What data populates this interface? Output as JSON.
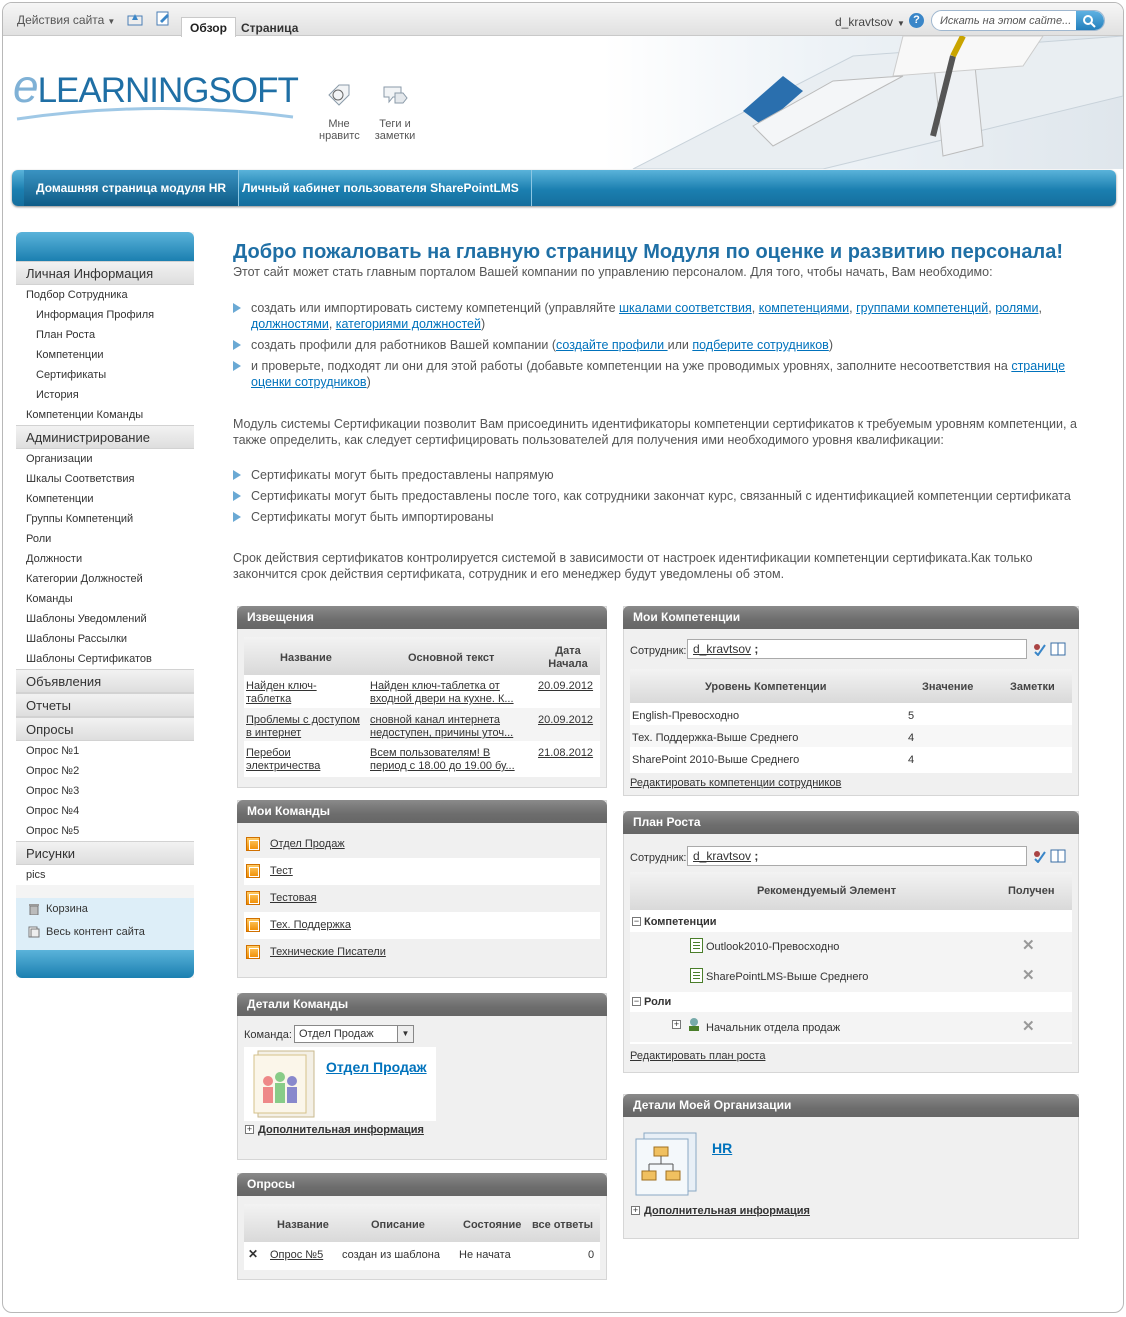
{
  "ribbon": {
    "site_actions": "Действия сайта",
    "tab_browse": "Обзор",
    "tab_page": "Страница",
    "user": "d_kravtsov",
    "search_placeholder": "Искать на этом сайте..."
  },
  "header": {
    "logo": "LEARNINGSOFT",
    "logo_e": "e",
    "like_label": "Мне нравитс",
    "tags_label": "Теги и заметки"
  },
  "topnav": {
    "home": "Домашняя страница модуля HR",
    "cabinet": "Личный кабинет пользователя SharePointLMS"
  },
  "sidebar": {
    "h_personal": "Личная Информация",
    "employee_selection": "Подбор Сотрудника",
    "profile_info": "Информация Профиля",
    "growth_plan": "План Роста",
    "competencies": "Компетенции",
    "certificates": "Сертификаты",
    "history": "История",
    "team_competencies": "Компетенции Команды",
    "h_admin": "Администрирование",
    "organizations": "Организации",
    "scales": "Шкалы Соответствия",
    "admin_competencies": "Компетенции",
    "competency_groups": "Группы Компетенций",
    "roles": "Роли",
    "positions": "Должности",
    "position_categories": "Категории Должностей",
    "teams": "Команды",
    "notify_templates": "Шаблоны Уведомлений",
    "mail_templates": "Шаблоны Рассылки",
    "cert_templates": "Шаблоны Сертификатов",
    "h_announcements": "Объявления",
    "h_reports": "Отчеты",
    "h_surveys": "Опросы",
    "survey1": "Опрос №1",
    "survey2": "Опрос №2",
    "survey3": "Опрос №3",
    "survey4": "Опрос №4",
    "survey5": "Опрос №5",
    "h_pictures": "Рисунки",
    "pics": "pics",
    "recycle": "Корзина",
    "all_content": "Весь контент сайта"
  },
  "main": {
    "title": "Добро пожаловать на главную страницу Модуля по оценке и развитию персонала!",
    "intro": "Этот сайт может стать главным порталом Вашей компании по управлению персоналом. Для того, чтобы начать, Вам необходимо:",
    "b1_text": "создать или импортировать систему компетенций (управляйте ",
    "b1_l1": "шкалами соответствия",
    "b1_l2": "компетенциями",
    "b1_l3": "группами компетенций",
    "b1_l4": "ролями",
    "b1_l5": "должностями",
    "b1_l6": "категориями должностей",
    "b2_text": "создать профили для работников Вашей компании (",
    "b2_l1": "создайте профили ",
    "b2_mid": "или ",
    "b2_l2": "подберите сотрудников",
    "b3_text": "и проверьте, подходят ли они для этой работы (добавьте компетенции на уже проводимых уровнях, заполните несоответствия на ",
    "b3_l1": "странице",
    "b3_l2": "оценки сотрудников",
    "cert_para": "Модуль системы Сертификации позволит Вам присоединить идентификаторы компетенции сертификатов к требуемым уровням компетенции, а также определить, как следует сертифицировать пользователей для получения ими необходимого уровня квалификации:",
    "c1": "Сертификаты могут быть предоставлены напрямую",
    "c2": "Сертификаты могут быть предоставлены после того, как сотрудники закончат курс, связанный с идентификацией компетенции сертификата",
    "c3": "Сертификаты могут быть импортированы",
    "expiry_para": "Срок действия сертификатов контролируется системой в зависимости от настроек идентификации компетенции сертификата.Как только закончится срок действия сертификата, сотрудник и его менеджер будут уведомлены об этом."
  },
  "notices": {
    "title": "Извещения",
    "col_name": "Название",
    "col_body": "Основной текст",
    "col_date": "Дата Начала",
    "rows": [
      {
        "name": "Найден ключ-таблетка",
        "body": "Найден ключ-таблетка от входной двери на кухне. К...",
        "date": "20.09.2012"
      },
      {
        "name": "Проблемы с доступом в интернет",
        "body": "сновной канал интернета недоступен, причины уточ...",
        "date": "20.09.2012"
      },
      {
        "name": "Перебои электричества",
        "body": "Всем пользователям! В период с 18.00 до 19.00 бу...",
        "date": "21.08.2012"
      }
    ]
  },
  "my_teams": {
    "title": "Мои Команды",
    "items": [
      "Отдел Продаж",
      "Тест",
      "Тестовая",
      "Тех. Поддержка",
      "Технические Писатели"
    ]
  },
  "team_details": {
    "title": "Детали Команды",
    "label": "Команда:",
    "selected": "Отдел Продаж",
    "team_name": "Отдел Продаж",
    "more": "Дополнительная информация"
  },
  "surveys": {
    "title": "Опросы",
    "col_name": "Название",
    "col_desc": "Описание",
    "col_status": "Состояние",
    "col_answers": "все ответы",
    "rows": [
      {
        "name": "Опрос №5",
        "desc": "создан из шаблона",
        "status": "Не начата",
        "answers": "0"
      }
    ]
  },
  "my_comp": {
    "title": "Мои Компетенции",
    "emp_label": "Сотрудник:",
    "emp_value": "d_kravtsov",
    "emp_suffix": ";",
    "col_level": "Уровень Компетенции",
    "col_value": "Значение",
    "col_notes": "Заметки",
    "rows": [
      {
        "level": "English-Превосходно",
        "value": "5"
      },
      {
        "level": "Тех. Поддержка-Выше Среднего",
        "value": "4"
      },
      {
        "level": "SharePoint 2010-Выше Среднего",
        "value": "4"
      }
    ],
    "edit": "Редактировать компетенции сотрудников"
  },
  "growth": {
    "title": "План Роста",
    "emp_label": "Сотрудник:",
    "emp_value": "d_kravtsov",
    "emp_suffix": ";",
    "col_item": "Рекомендуемый Элемент",
    "col_received": "Получен",
    "g1": "Компетенции",
    "i1": "Outlook2010-Превосходно",
    "i2": "SharePointLMS-Выше Среднего",
    "g2": "Роли",
    "i3": "Начальник отдела продаж",
    "edit": "Редактировать план роста"
  },
  "org": {
    "title": "Детали Моей Организации",
    "name": "HR",
    "more": "Дополнительная информация"
  },
  "colors": {
    "accent": "#1f6fa5",
    "link": "#0072bc",
    "nav": "#1b7fb0"
  }
}
